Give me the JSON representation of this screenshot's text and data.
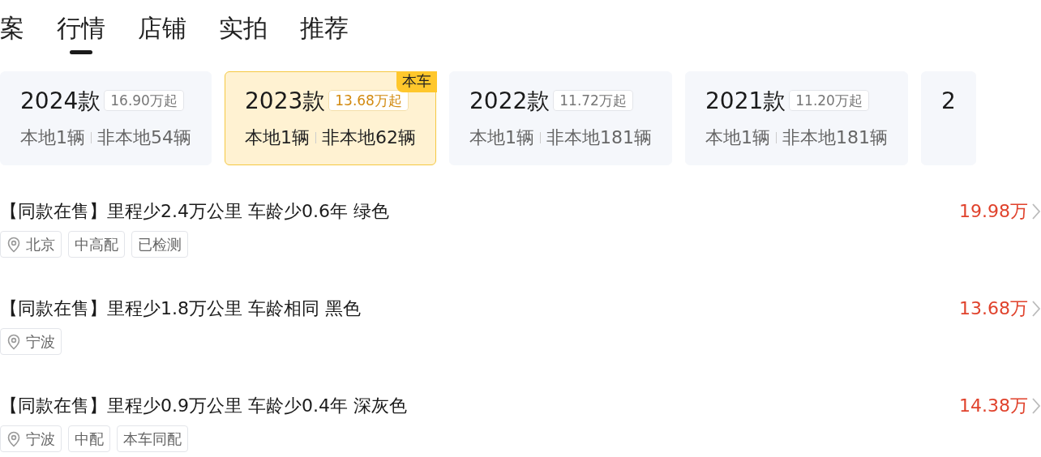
{
  "tabs": [
    {
      "label": "案",
      "selected": false
    },
    {
      "label": "行情",
      "selected": true
    },
    {
      "label": "店铺",
      "selected": false
    },
    {
      "label": "实拍",
      "selected": false
    },
    {
      "label": "推荐",
      "selected": false
    }
  ],
  "model_years": [
    {
      "year": "2024款",
      "price": "16.90万起",
      "local": "本地1辆",
      "nonlocal": "非本地54辆",
      "selected": false
    },
    {
      "year": "2023款",
      "price": "13.68万起",
      "local": "本地1辆",
      "nonlocal": "非本地62辆",
      "selected": true,
      "badge": "本车"
    },
    {
      "year": "2022款",
      "price": "11.72万起",
      "local": "本地1辆",
      "nonlocal": "非本地181辆",
      "selected": false
    },
    {
      "year": "2021款",
      "price": "11.20万起",
      "local": "本地1辆",
      "nonlocal": "非本地181辆",
      "selected": false
    },
    {
      "year": "2",
      "selected": false
    }
  ],
  "listings": [
    {
      "title": "【同款在售】里程少2.4万公里 车龄少0.6年 绿色",
      "price": "19.98万",
      "tags": [
        {
          "kind": "location",
          "text": "北京"
        },
        {
          "kind": "plain",
          "text": "中高配"
        },
        {
          "kind": "plain",
          "text": "已检测"
        }
      ]
    },
    {
      "title": "【同款在售】里程少1.8万公里 车龄相同 黑色",
      "price": "13.68万",
      "tags": [
        {
          "kind": "location",
          "text": "宁波"
        }
      ]
    },
    {
      "title": "【同款在售】里程少0.9万公里 车龄少0.4年 深灰色",
      "price": "14.38万",
      "tags": [
        {
          "kind": "location",
          "text": "宁波"
        },
        {
          "kind": "plain",
          "text": "中配"
        },
        {
          "kind": "plain",
          "text": "本车同配"
        }
      ]
    }
  ]
}
